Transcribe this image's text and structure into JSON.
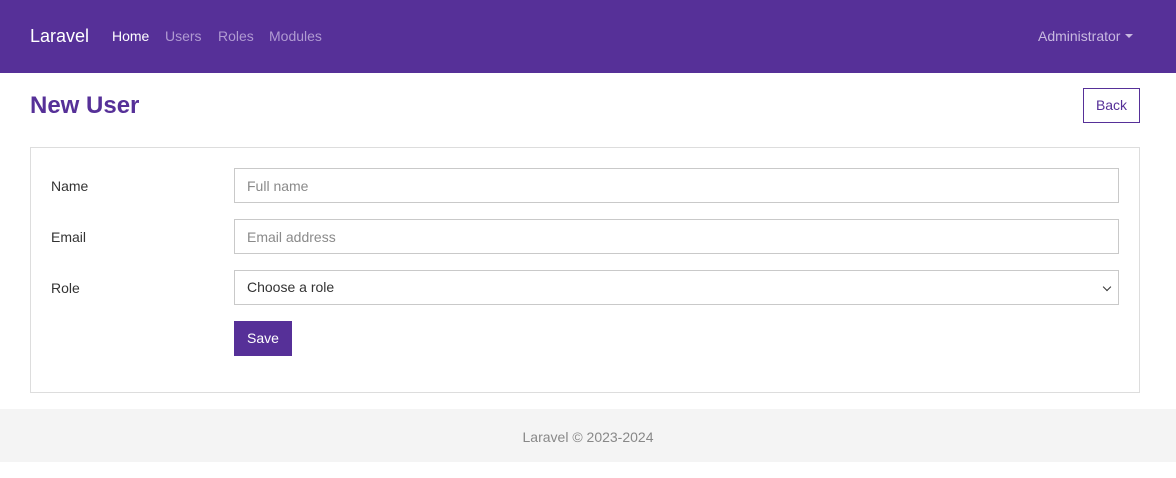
{
  "navbar": {
    "brand": "Laravel",
    "links": [
      {
        "label": "Home",
        "active": true
      },
      {
        "label": "Users",
        "active": false
      },
      {
        "label": "Roles",
        "active": false
      },
      {
        "label": "Modules",
        "active": false
      }
    ],
    "user_menu": {
      "label": "Administrator",
      "icon": "caret-down-icon"
    }
  },
  "header": {
    "title": "New User",
    "back_label": "Back"
  },
  "form": {
    "name": {
      "label": "Name",
      "value": "",
      "placeholder": "Full name"
    },
    "email": {
      "label": "Email",
      "value": "",
      "placeholder": "Email address"
    },
    "role": {
      "label": "Role",
      "selected": "Choose a role",
      "icon": "chevron-down-icon"
    },
    "save_label": "Save"
  },
  "footer": {
    "text": "Laravel © 2023-2024"
  },
  "colors": {
    "brand": "#563098",
    "nav_inactive": "#b09ad2",
    "footer_bg": "#f4f4f4"
  }
}
